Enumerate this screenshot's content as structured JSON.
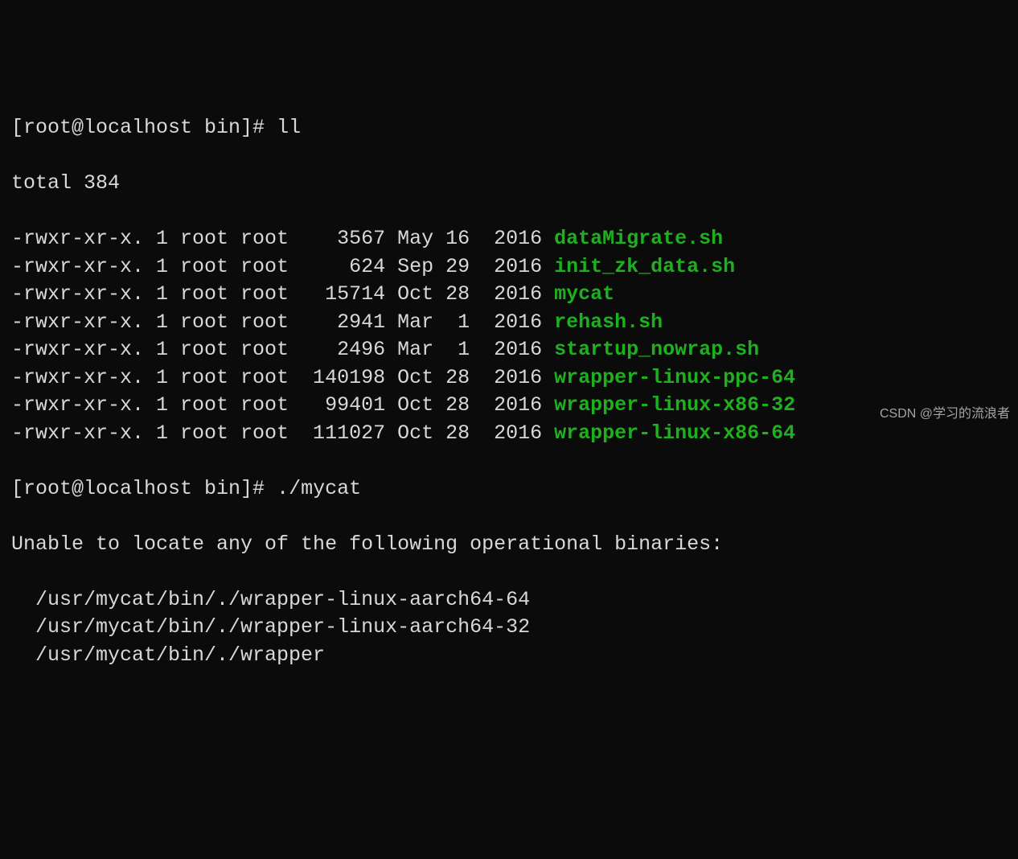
{
  "prompt1_prefix": "[root@localhost bin]# ",
  "cmd1": "ll",
  "total_line": "total 384",
  "rows": [
    {
      "perm": "-rwxr-xr-x.",
      "links": "1",
      "owner": "root",
      "group": "root",
      "size": "   3567",
      "month": "May",
      "day": "16",
      "year": " 2016",
      "name": "dataMigrate.sh"
    },
    {
      "perm": "-rwxr-xr-x.",
      "links": "1",
      "owner": "root",
      "group": "root",
      "size": "    624",
      "month": "Sep",
      "day": "29",
      "year": " 2016",
      "name": "init_zk_data.sh"
    },
    {
      "perm": "-rwxr-xr-x.",
      "links": "1",
      "owner": "root",
      "group": "root",
      "size": "  15714",
      "month": "Oct",
      "day": "28",
      "year": " 2016",
      "name": "mycat"
    },
    {
      "perm": "-rwxr-xr-x.",
      "links": "1",
      "owner": "root",
      "group": "root",
      "size": "   2941",
      "month": "Mar",
      "day": " 1",
      "year": " 2016",
      "name": "rehash.sh"
    },
    {
      "perm": "-rwxr-xr-x.",
      "links": "1",
      "owner": "root",
      "group": "root",
      "size": "   2496",
      "month": "Mar",
      "day": " 1",
      "year": " 2016",
      "name": "startup_nowrap.sh"
    },
    {
      "perm": "-rwxr-xr-x.",
      "links": "1",
      "owner": "root",
      "group": "root",
      "size": " 140198",
      "month": "Oct",
      "day": "28",
      "year": " 2016",
      "name": "wrapper-linux-ppc-64"
    },
    {
      "perm": "-rwxr-xr-x.",
      "links": "1",
      "owner": "root",
      "group": "root",
      "size": "  99401",
      "month": "Oct",
      "day": "28",
      "year": " 2016",
      "name": "wrapper-linux-x86-32"
    },
    {
      "perm": "-rwxr-xr-x.",
      "links": "1",
      "owner": "root",
      "group": "root",
      "size": " 111027",
      "month": "Oct",
      "day": "28",
      "year": " 2016",
      "name": "wrapper-linux-x86-64"
    }
  ],
  "prompt2_prefix": "[root@localhost bin]# ",
  "cmd2": "./mycat",
  "error_header": "Unable to locate any of the following operational binaries:",
  "error_lines": [
    "  /usr/mycat/bin/./wrapper-linux-aarch64-64",
    "  /usr/mycat/bin/./wrapper-linux-aarch64-32",
    "  /usr/mycat/bin/./wrapper"
  ],
  "watermark": "CSDN @学习的流浪者"
}
